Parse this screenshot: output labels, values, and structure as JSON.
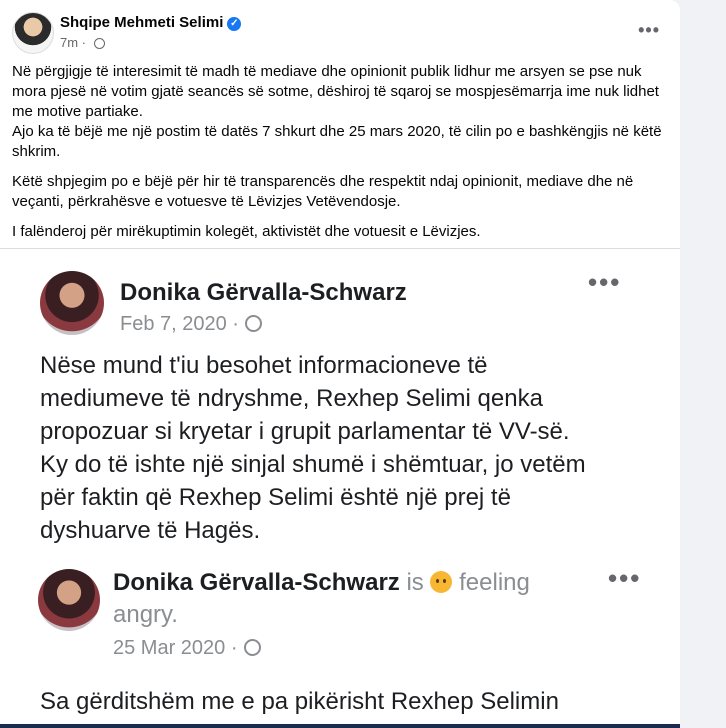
{
  "post": {
    "author": "Shqipe Mehmeti Selimi",
    "time": "7m",
    "paragraphs": [
      [
        "Në përgjigje të interesimit të madh të mediave dhe opinionit publik lidhur me arsyen se pse nuk",
        "mora pjesë në votim gjatë seancës së sotme, dëshiroj të sqaroj se mospjesëmarrja ime nuk lidhet",
        "me motive partiake.",
        "Ajo ka të bëjë me një postim të datës 7 shkurt dhe 25 mars 2020, të cilin po e bashkëngjis në këtë",
        "shkrim."
      ],
      [
        "Këtë shpjegim po e bëjë për hir të transparencës dhe respektit ndaj opinionit, mediave dhe në",
        "veçanti, përkrahësve e votuesve të Lëvizjes Vetëvendosje."
      ],
      [
        "I falënderoj për mirëkuptimin kolegët, aktivistët dhe votuesit e Lëvizjes."
      ]
    ]
  },
  "image": {
    "post1": {
      "author": "Donika Gërvalla-Schwarz",
      "date": "Feb 7, 2020 ·",
      "lines": [
        "Nëse mund t'iu besohet informacioneve të",
        "mediumeve të ndryshme, Rexhep Selimi qenka",
        "propozuar si kryetar i grupit parlamentar të VV-së.",
        "Ky do të ishte një sinjal shumë i shëmtuar, jo vetëm",
        "për faktin që Rexhep Selimi është një prej të",
        "dyshuarve të Hagës."
      ]
    },
    "post2": {
      "author": "Donika Gërvalla-Schwarz",
      "is": "is",
      "feeling": "feeling",
      "mood": "angry.",
      "date": "25 Mar 2020 ·",
      "line": "Sa gërditshëm me e pa pikërisht Rexhep Selimin"
    }
  }
}
